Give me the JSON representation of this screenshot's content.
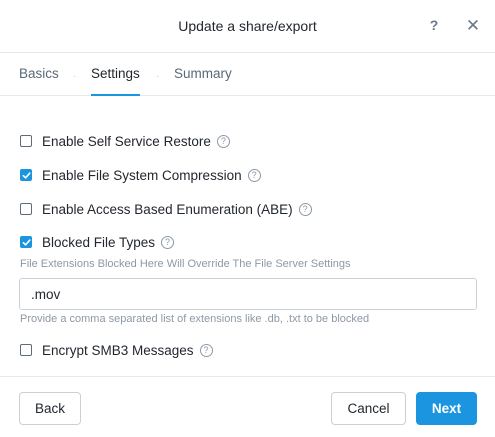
{
  "dialog": {
    "title": "Update a share/export",
    "help_glyph": "?",
    "close_glyph": "✕"
  },
  "tabs": [
    {
      "label": "Basics",
      "active": false
    },
    {
      "label": "Settings",
      "active": true
    },
    {
      "label": "Summary",
      "active": false
    }
  ],
  "options": {
    "self_service_restore": {
      "label": "Enable Self Service Restore",
      "checked": false
    },
    "compression": {
      "label": "Enable File System Compression",
      "checked": true
    },
    "abe": {
      "label": "Enable Access Based Enumeration (ABE)",
      "checked": false
    },
    "blocked_types": {
      "label": "Blocked File Types",
      "checked": true
    },
    "smb3": {
      "label": "Encrypt SMB3 Messages",
      "checked": false
    }
  },
  "blocked": {
    "note": "File Extensions Blocked Here Will Override The File Server Settings",
    "value": ".mov",
    "hint": "Provide a comma separated list of extensions like .db, .txt to be blocked"
  },
  "icons": {
    "help": "question-circle-icon",
    "check": "checkmark-icon"
  },
  "footer": {
    "back_label": "Back",
    "cancel_label": "Cancel",
    "next_label": "Next"
  },
  "colors": {
    "accent": "#1b95e0",
    "text": "#22272e",
    "muted": "#8d99a6"
  }
}
